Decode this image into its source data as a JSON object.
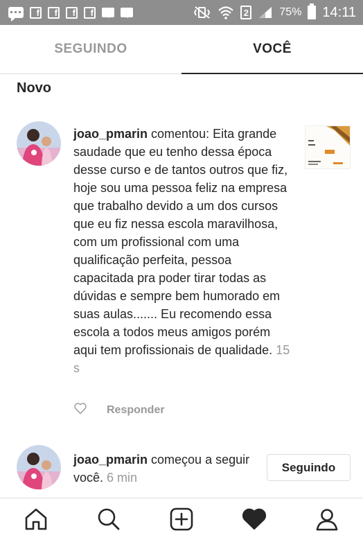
{
  "status_bar": {
    "battery": "75%",
    "time": "14:11",
    "sim_slot": "2",
    "icons": [
      "chat-icon",
      "facebook-icon",
      "facebook-icon",
      "facebook-icon",
      "facebook-icon",
      "message-icon",
      "message-icon",
      "mute-vibrate-icon",
      "wifi-icon",
      "sim-icon",
      "signal-icon",
      "battery-icon"
    ]
  },
  "tabs": [
    {
      "label": "SEGUINDO",
      "active": false
    },
    {
      "label": "VOCÊ",
      "active": true
    }
  ],
  "section_title": "Novo",
  "notifications": [
    {
      "username": "joao_pmarin",
      "text": " comentou: Eita grande saudade que eu tenho dessa época desse curso e de tantos outros que fiz, hoje sou uma pessoa feliz na empresa que trabalho devido a um dos cursos que eu fiz nessa escola maravilhosa, com um profissional com uma qualificação perfeita, pessoa capacitada pra poder tirar todas as dúvidas e sempre bem humorado em suas aulas....... Eu recomendo essa escola a todos meus amigos porém aqui tem profissionais de qualidade.",
      "time": " 15 s",
      "reply_label": "Responder"
    },
    {
      "username": "joao_pmarin",
      "text": " começou a seguir você.",
      "time": " 6 min",
      "button_label": "Seguindo"
    }
  ],
  "bottom_nav": [
    "home-icon",
    "search-icon",
    "new-post-icon",
    "activity-heart-icon",
    "profile-icon"
  ],
  "colors": {
    "status_bar": "#8e8e8e",
    "text": "#262626",
    "muted": "#999999",
    "divider": "#dbdbdb"
  }
}
